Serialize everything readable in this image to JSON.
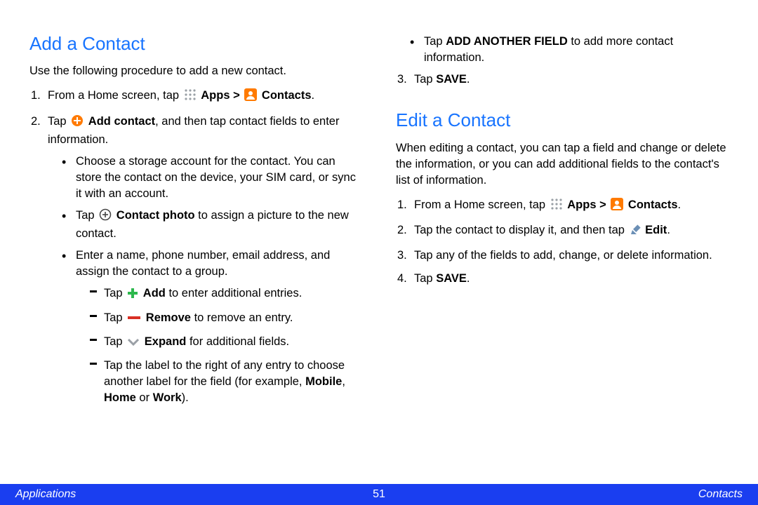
{
  "add": {
    "heading": "Add a Contact",
    "intro": "Use the following procedure to add a new contact.",
    "step1_a": "From a Home screen, tap ",
    "apps_b": "Apps",
    "gt": " > ",
    "contacts_b": "Contacts",
    "step2_a": "Tap ",
    "addcontact_b": "Add contact",
    "step2_c": ", and then tap contact fields to enter information.",
    "sub1": "Choose a storage account for the contact. You can store the contact on the device, your SIM card, or sync it with an account.",
    "sub2_a": "Tap ",
    "sub2_b": "Contact photo",
    "sub2_c": " to assign a picture to the new contact.",
    "sub3": "Enter a name, phone number, email address, and assign the contact to a group.",
    "d1_a": "Tap ",
    "d1_b": "Add",
    "d1_c": " to enter additional entries.",
    "d2_a": "Tap ",
    "d2_b": "Remove",
    "d2_c": " to remove an entry.",
    "d3_a": "Tap ",
    "d3_b": "Expand",
    "d3_c": " for additional fields.",
    "d4_a": "Tap the label to the right of any entry to choose another label for the field (for example, ",
    "d4_b1": "Mobile",
    "d4_b2": "Home",
    "d4_b3": "Work",
    "d4_sep": ", ",
    "d4_or": " or ",
    "d4_end": ").",
    "sub4_a": "Tap ",
    "sub4_b": "ADD ANOTHER FIELD",
    "sub4_c": " to add more contact information.",
    "step3_a": "Tap ",
    "save_b": "SAVE",
    "step3_c": "."
  },
  "edit": {
    "heading": "Edit a Contact",
    "intro": "When editing a contact, you can tap a field and change or delete the information, or you can add additional fields to the contact's list of information.",
    "step1_a": "From a Home screen, tap ",
    "step2_a": "Tap the contact to display it, and then tap ",
    "edit_b": "Edit",
    "step3": "Tap any of the fields to add, change, or delete information.",
    "step4_a": "Tap ",
    "step4_c": "."
  },
  "footer": {
    "left": "Applications",
    "center": "51",
    "right": "Contacts"
  }
}
